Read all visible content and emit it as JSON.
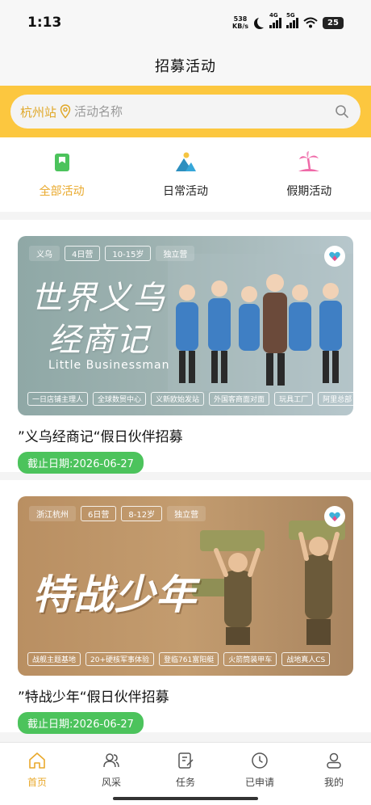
{
  "status_bar": {
    "time": "1:13",
    "net_speed_value": "538",
    "net_speed_unit": "KB/s",
    "signal_1_label": "4G",
    "signal_2_label": "5G",
    "battery": "25"
  },
  "header": {
    "title": "招募活动"
  },
  "search": {
    "city": "杭州站",
    "placeholder": "活动名称"
  },
  "categories": [
    {
      "label": "全部活动",
      "active": true,
      "icon": "bookmark-icon"
    },
    {
      "label": "日常活动",
      "active": false,
      "icon": "mountain-icon"
    },
    {
      "label": "假期活动",
      "active": false,
      "icon": "palm-tree-icon"
    }
  ],
  "cards": [
    {
      "banner": {
        "tags_top": [
          "义乌",
          "4日营",
          "10-15岁",
          "独立营"
        ],
        "title_line_1": "世界义乌",
        "title_line_2": "经商记",
        "subtitle": "Little Businessman",
        "tags_bottom": [
          "一日店铺主理人",
          "全球数贸中心",
          "义新欧始发站",
          "外国客商面对面",
          "玩具工厂",
          "阿里总部"
        ]
      },
      "title": "”义乌经商记“假日伙伴招募",
      "deadline": "截止日期:2026-06-27"
    },
    {
      "banner": {
        "tags_top": [
          "浙江杭州",
          "6日营",
          "8-12岁",
          "独立营"
        ],
        "title_line_1": "特战少年",
        "tags_bottom": [
          "战舰主题基地",
          "20+硬核军事体验",
          "登临761富阳艇",
          "火箭筒装甲车",
          "战地真人CS"
        ]
      },
      "title": "”特战少年“假日伙伴招募",
      "deadline": "截止日期:2026-06-27"
    }
  ],
  "tabbar": [
    {
      "label": "首页",
      "active": true,
      "icon": "home-icon"
    },
    {
      "label": "风采",
      "active": false,
      "icon": "people-icon"
    },
    {
      "label": "任务",
      "active": false,
      "icon": "task-icon"
    },
    {
      "label": "已申请",
      "active": false,
      "icon": "clock-icon"
    },
    {
      "label": "我的",
      "active": false,
      "icon": "profile-icon"
    }
  ],
  "colors": {
    "accent": "#e9a92c",
    "search_band": "#fcc73f",
    "deadline_green": "#4cc35c"
  }
}
